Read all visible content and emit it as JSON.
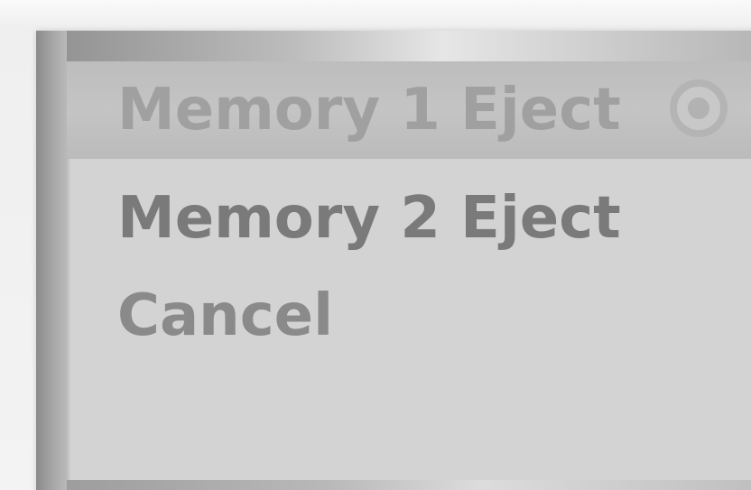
{
  "menu": {
    "items": [
      {
        "label": "Memory 1 Eject",
        "selected": true
      },
      {
        "label": "Memory 2 Eject",
        "selected": false
      },
      {
        "label": "Cancel",
        "selected": false
      }
    ],
    "selected_icon": "radio-selected-icon"
  },
  "colors": {
    "panel": "#d3d3d3",
    "selection": "#bdbdbd",
    "text": "#7e7e7e",
    "frame": "#9a9a9a"
  }
}
